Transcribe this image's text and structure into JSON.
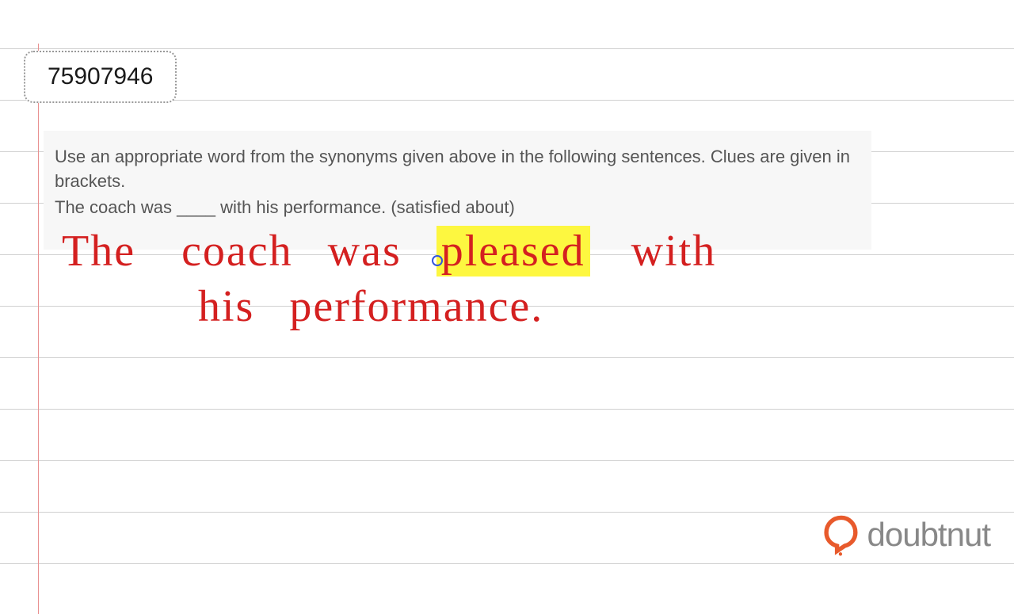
{
  "id_badge": "75907946",
  "question": {
    "line1": "Use an appropriate word from the synonyms given above in the following sentences. Clues are given in brackets.",
    "line2_prefix": "The coach was ____ with his performance. (",
    "line2_underlined": "satisfied about",
    "line2_suffix": ")"
  },
  "answer": {
    "word1": "The",
    "word2": "coach",
    "word3": "was",
    "word4_highlighted": "pleased",
    "word5": "with",
    "word6": "his",
    "word7": "performance."
  },
  "logo": {
    "text": "doubtnut"
  }
}
